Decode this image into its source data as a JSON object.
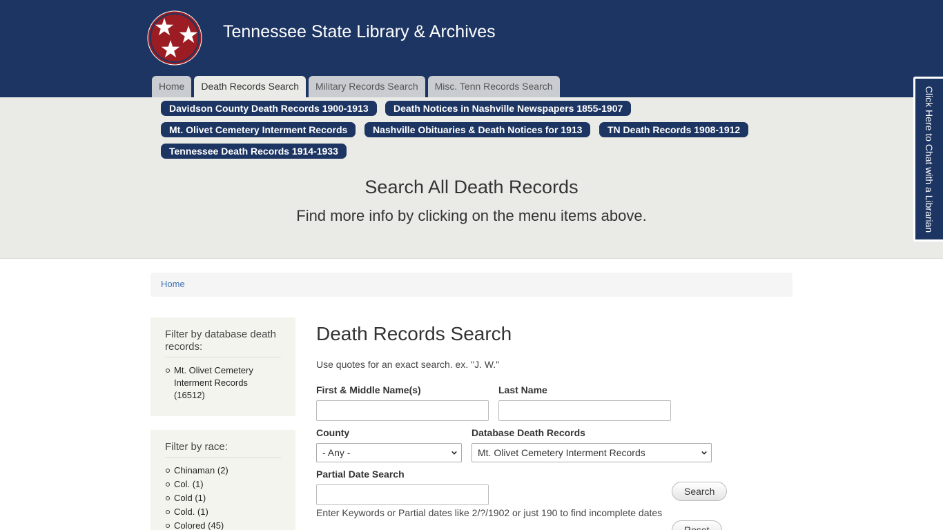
{
  "header": {
    "site_title": "Tennessee State Library & Archives"
  },
  "tabs": [
    {
      "label": "Home"
    },
    {
      "label": "Death Records Search"
    },
    {
      "label": "Military Records Search"
    },
    {
      "label": "Misc. Tenn Records Search"
    }
  ],
  "sub_links": [
    {
      "label": "Davidson County Death Records 1900-1913"
    },
    {
      "label": "Death Notices in Nashville Newspapers 1855-1907"
    },
    {
      "label": "Mt. Olivet Cemetery Interment Records"
    },
    {
      "label": "Nashville Obituaries & Death Notices for 1913"
    },
    {
      "label": "TN Death Records 1908-1912"
    },
    {
      "label": "Tennessee Death Records 1914-1933"
    }
  ],
  "band": {
    "title": "Search All Death Records",
    "subtitle": "Find more info by clicking on the menu items above."
  },
  "chat": {
    "label": "Click Here to Chat with a Librarian"
  },
  "breadcrumb": {
    "home": "Home"
  },
  "filters": {
    "database": {
      "title": "Filter by database death records:",
      "items": [
        "Mt. Olivet Cemetery Interment Records (16512)"
      ]
    },
    "race": {
      "title": "Filter by race:",
      "items": [
        "Chinaman (2)",
        "Col. (1)",
        "Cold (1)",
        "Cold. (1)",
        "Colored (45)"
      ]
    }
  },
  "form": {
    "title": "Death Records Search",
    "hint": "Use quotes for an exact search. ex. \"J. W.\"",
    "first_name_label": "First & Middle Name(s)",
    "last_name_label": "Last Name",
    "county_label": "County",
    "county_value": "- Any -",
    "database_label": "Database Death Records",
    "database_value": "Mt. Olivet Cemetery Interment Records",
    "partial_date_label": "Partial Date Search",
    "search_button": "Search",
    "reset_button": "Reset",
    "help_text": "Enter Keywords or Partial dates like 2/?/1902 or just 190 to find incomplete dates"
  },
  "colors": {
    "brand_navy": "#1d3562",
    "band_bg": "#eaebe6",
    "logo_red": "#9b1c23"
  }
}
